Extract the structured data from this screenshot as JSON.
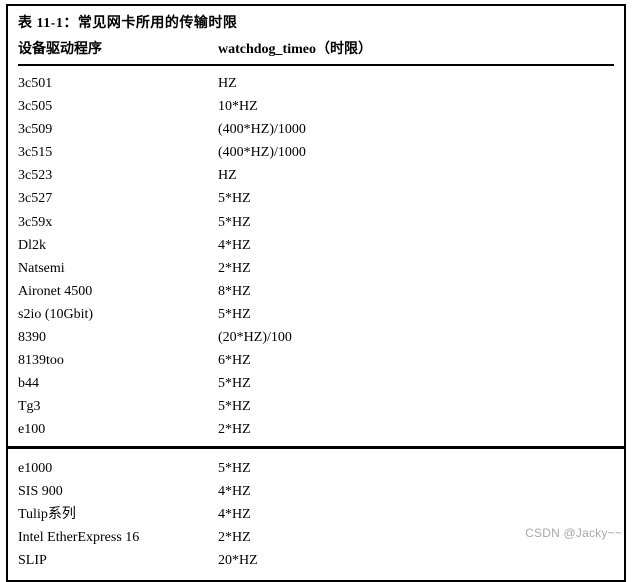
{
  "title": "表 11-1：常见网卡所用的传输时限",
  "header": {
    "col1": "设备驱动程序",
    "col2": "watchdog_timeo（时限）"
  },
  "rows_top": [
    {
      "driver": "3c501",
      "timeo": "HZ"
    },
    {
      "driver": "3c505",
      "timeo": "10*HZ"
    },
    {
      "driver": "3c509",
      "timeo": "(400*HZ)/1000"
    },
    {
      "driver": "3c515",
      "timeo": "(400*HZ)/1000"
    },
    {
      "driver": "3c523",
      "timeo": "HZ"
    },
    {
      "driver": "3c527",
      "timeo": "5*HZ"
    },
    {
      "driver": "3c59x",
      "timeo": "5*HZ"
    },
    {
      "driver": "Dl2k",
      "timeo": "4*HZ"
    },
    {
      "driver": "Natsemi",
      "timeo": "2*HZ"
    },
    {
      "driver": "Aironet 4500",
      "timeo": "8*HZ"
    },
    {
      "driver": "s2io (10Gbit)",
      "timeo": "5*HZ"
    },
    {
      "driver": "8390",
      "timeo": "(20*HZ)/100"
    },
    {
      "driver": "8139too",
      "timeo": "6*HZ"
    },
    {
      "driver": "b44",
      "timeo": "5*HZ"
    },
    {
      "driver": "Tg3",
      "timeo": "5*HZ"
    },
    {
      "driver": "e100",
      "timeo": "2*HZ"
    }
  ],
  "rows_bottom": [
    {
      "driver": "e1000",
      "timeo": "5*HZ"
    },
    {
      "driver": "SIS 900",
      "timeo": "4*HZ"
    },
    {
      "driver": "Tulip系列",
      "timeo": "4*HZ"
    },
    {
      "driver": "Intel EtherExpress 16",
      "timeo": "2*HZ"
    },
    {
      "driver": "SLIP",
      "timeo": "20*HZ"
    }
  ],
  "watermark": "CSDN @Jacky~~"
}
